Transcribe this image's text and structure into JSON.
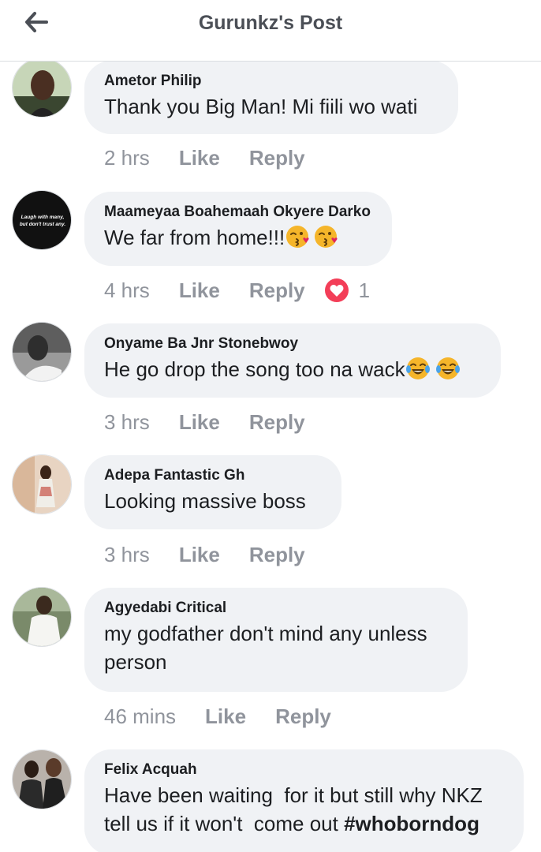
{
  "header": {
    "title": "Gurunkz's Post"
  },
  "comments": [
    {
      "author": "Ametor Philip",
      "text": "Thank you Big Man! Mi fiili wo wati",
      "time": "2 hrs",
      "like_label": "Like",
      "reply_label": "Reply"
    },
    {
      "author": "Maameyaa Boahemaah Okyere  Darko",
      "text": "We far from home!!!",
      "avatar_text": "Laugh with many, but don't trust any.",
      "emojis": [
        "kissing-heart-emoji",
        "kissing-heart-emoji"
      ],
      "time": "4 hrs",
      "like_label": "Like",
      "reply_label": "Reply",
      "reaction": "love",
      "reaction_count": "1"
    },
    {
      "author": "Onyame Ba Jnr Stonebwoy",
      "text": "He go drop the song too na wack",
      "emojis": [
        "tears-of-joy-emoji",
        "tears-of-joy-emoji"
      ],
      "time": "3 hrs",
      "like_label": "Like",
      "reply_label": "Reply"
    },
    {
      "author": "Adepa Fantastic Gh",
      "text": "Looking massive boss",
      "time": "3 hrs",
      "like_label": "Like",
      "reply_label": "Reply"
    },
    {
      "author": "Agyedabi Critical",
      "text_line1": "my godfather don't mind any unless",
      "text_line2": "person",
      "time": "46 mins",
      "like_label": "Like",
      "reply_label": "Reply"
    },
    {
      "author": "Felix Acquah",
      "text_line1": "Have been waiting  for it but still why NKZ",
      "text_line2": "tell us if it won't  come out ",
      "hashtag": "#whoborndog"
    }
  ],
  "colors": {
    "bubble": "#f0f2f5",
    "meta_text": "#90949c",
    "title_text": "#4b4f56",
    "love_reaction": "#f33e58"
  }
}
